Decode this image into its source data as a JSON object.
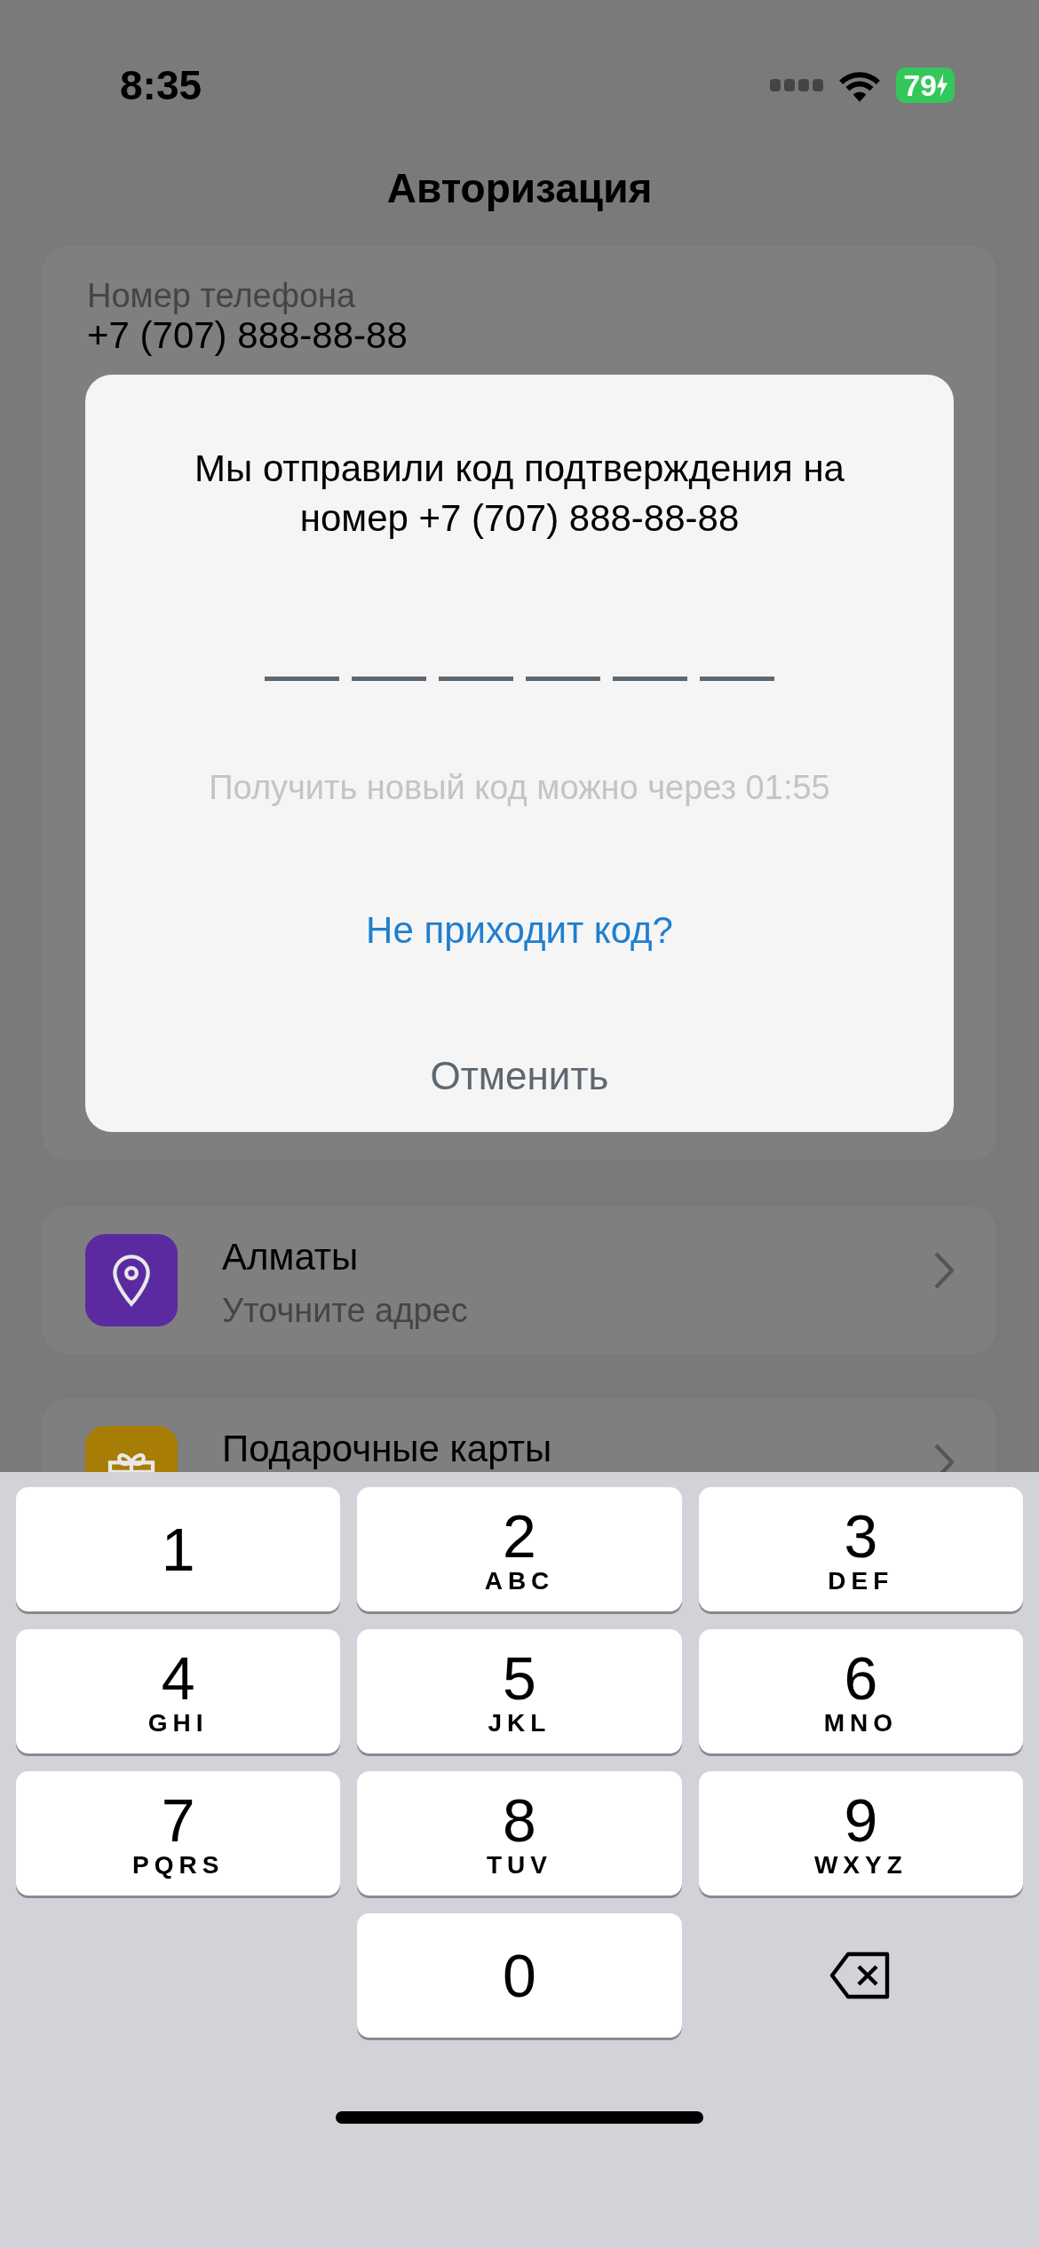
{
  "status_bar": {
    "time": "8:35",
    "battery": "79"
  },
  "title": "Авторизация",
  "phone_field": {
    "label": "Номер телефона",
    "value": "+7 (707) 888-88-88"
  },
  "rows": [
    {
      "kind": "location",
      "title": "Алматы",
      "subtitle": "Уточните адрес",
      "color": "#5b2aa0"
    },
    {
      "kind": "gift",
      "title": "Подарочные карты",
      "color": "#a77d05"
    }
  ],
  "dialog": {
    "message": "Мы отправили код подтверждения на номер +7 (707) 888-88-88",
    "code_slots": [
      {
        "filled": false
      },
      {
        "filled": false
      },
      {
        "filled": false
      },
      {
        "filled": false
      },
      {
        "filled": false
      },
      {
        "filled": false
      }
    ],
    "timer": "Получить новый код можно через 01:55",
    "link": "Не приходит код?",
    "cancel": "Отменить"
  },
  "keyboard": [
    {
      "kind": "digit",
      "digit": "1"
    },
    {
      "kind": "digit",
      "digit": "2",
      "letters": "ABC"
    },
    {
      "kind": "digit",
      "digit": "3",
      "letters": "DEF"
    },
    {
      "kind": "digit",
      "digit": "4",
      "letters": "GHI"
    },
    {
      "kind": "digit",
      "digit": "5",
      "letters": "JKL"
    },
    {
      "kind": "digit",
      "digit": "6",
      "letters": "MNO"
    },
    {
      "kind": "digit",
      "digit": "7",
      "letters": "PQRS"
    },
    {
      "kind": "digit",
      "digit": "8",
      "letters": "TUV"
    },
    {
      "kind": "digit",
      "digit": "9",
      "letters": "WXYZ"
    },
    {
      "kind": "empty"
    },
    {
      "kind": "digit",
      "digit": "0"
    },
    {
      "kind": "delete"
    }
  ]
}
